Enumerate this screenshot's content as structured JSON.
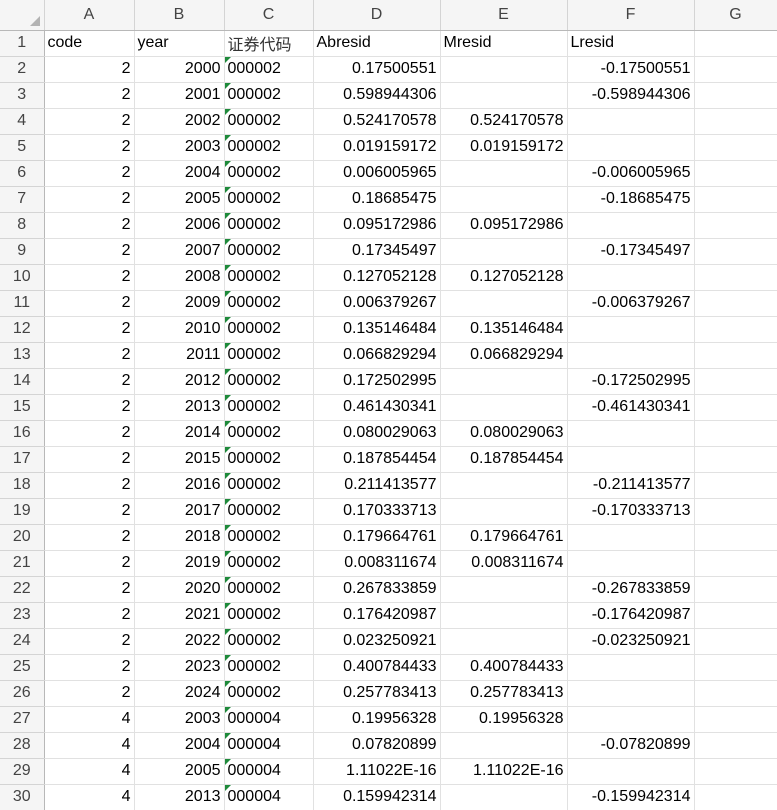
{
  "columns": [
    "A",
    "B",
    "C",
    "D",
    "E",
    "F",
    "G"
  ],
  "header_row": {
    "row_number": "1",
    "cells": [
      "code",
      "year",
      "证券代码",
      "Abresid",
      "Mresid",
      "Lresid",
      ""
    ]
  },
  "rows": [
    {
      "n": "2",
      "code": "2",
      "year": "2000",
      "sec": "000002",
      "ab": "0.17500551",
      "m": "",
      "l": "-0.17500551"
    },
    {
      "n": "3",
      "code": "2",
      "year": "2001",
      "sec": "000002",
      "ab": "0.598944306",
      "m": "",
      "l": "-0.598944306"
    },
    {
      "n": "4",
      "code": "2",
      "year": "2002",
      "sec": "000002",
      "ab": "0.524170578",
      "m": "0.524170578",
      "l": ""
    },
    {
      "n": "5",
      "code": "2",
      "year": "2003",
      "sec": "000002",
      "ab": "0.019159172",
      "m": "0.019159172",
      "l": ""
    },
    {
      "n": "6",
      "code": "2",
      "year": "2004",
      "sec": "000002",
      "ab": "0.006005965",
      "m": "",
      "l": "-0.006005965"
    },
    {
      "n": "7",
      "code": "2",
      "year": "2005",
      "sec": "000002",
      "ab": "0.18685475",
      "m": "",
      "l": "-0.18685475"
    },
    {
      "n": "8",
      "code": "2",
      "year": "2006",
      "sec": "000002",
      "ab": "0.095172986",
      "m": "0.095172986",
      "l": ""
    },
    {
      "n": "9",
      "code": "2",
      "year": "2007",
      "sec": "000002",
      "ab": "0.17345497",
      "m": "",
      "l": "-0.17345497"
    },
    {
      "n": "10",
      "code": "2",
      "year": "2008",
      "sec": "000002",
      "ab": "0.127052128",
      "m": "0.127052128",
      "l": ""
    },
    {
      "n": "11",
      "code": "2",
      "year": "2009",
      "sec": "000002",
      "ab": "0.006379267",
      "m": "",
      "l": "-0.006379267"
    },
    {
      "n": "12",
      "code": "2",
      "year": "2010",
      "sec": "000002",
      "ab": "0.135146484",
      "m": "0.135146484",
      "l": ""
    },
    {
      "n": "13",
      "code": "2",
      "year": "2011",
      "sec": "000002",
      "ab": "0.066829294",
      "m": "0.066829294",
      "l": ""
    },
    {
      "n": "14",
      "code": "2",
      "year": "2012",
      "sec": "000002",
      "ab": "0.172502995",
      "m": "",
      "l": "-0.172502995"
    },
    {
      "n": "15",
      "code": "2",
      "year": "2013",
      "sec": "000002",
      "ab": "0.461430341",
      "m": "",
      "l": "-0.461430341"
    },
    {
      "n": "16",
      "code": "2",
      "year": "2014",
      "sec": "000002",
      "ab": "0.080029063",
      "m": "0.080029063",
      "l": ""
    },
    {
      "n": "17",
      "code": "2",
      "year": "2015",
      "sec": "000002",
      "ab": "0.187854454",
      "m": "0.187854454",
      "l": ""
    },
    {
      "n": "18",
      "code": "2",
      "year": "2016",
      "sec": "000002",
      "ab": "0.211413577",
      "m": "",
      "l": "-0.211413577"
    },
    {
      "n": "19",
      "code": "2",
      "year": "2017",
      "sec": "000002",
      "ab": "0.170333713",
      "m": "",
      "l": "-0.170333713"
    },
    {
      "n": "20",
      "code": "2",
      "year": "2018",
      "sec": "000002",
      "ab": "0.179664761",
      "m": "0.179664761",
      "l": ""
    },
    {
      "n": "21",
      "code": "2",
      "year": "2019",
      "sec": "000002",
      "ab": "0.008311674",
      "m": "0.008311674",
      "l": ""
    },
    {
      "n": "22",
      "code": "2",
      "year": "2020",
      "sec": "000002",
      "ab": "0.267833859",
      "m": "",
      "l": "-0.267833859"
    },
    {
      "n": "23",
      "code": "2",
      "year": "2021",
      "sec": "000002",
      "ab": "0.176420987",
      "m": "",
      "l": "-0.176420987"
    },
    {
      "n": "24",
      "code": "2",
      "year": "2022",
      "sec": "000002",
      "ab": "0.023250921",
      "m": "",
      "l": "-0.023250921"
    },
    {
      "n": "25",
      "code": "2",
      "year": "2023",
      "sec": "000002",
      "ab": "0.400784433",
      "m": "0.400784433",
      "l": ""
    },
    {
      "n": "26",
      "code": "2",
      "year": "2024",
      "sec": "000002",
      "ab": "0.257783413",
      "m": "0.257783413",
      "l": ""
    },
    {
      "n": "27",
      "code": "4",
      "year": "2003",
      "sec": "000004",
      "ab": "0.19956328",
      "m": "0.19956328",
      "l": ""
    },
    {
      "n": "28",
      "code": "4",
      "year": "2004",
      "sec": "000004",
      "ab": "0.07820899",
      "m": "",
      "l": "-0.07820899"
    },
    {
      "n": "29",
      "code": "4",
      "year": "2005",
      "sec": "000004",
      "ab": "1.11022E-16",
      "m": "1.11022E-16",
      "l": ""
    },
    {
      "n": "30",
      "code": "4",
      "year": "2013",
      "sec": "000004",
      "ab": "0.159942314",
      "m": "",
      "l": "-0.159942314"
    }
  ],
  "colors": {
    "header_bg": "#f5f5f5",
    "gridline": "#e1e1e1",
    "text_number_marker": "#1e8a3a"
  },
  "icons": {
    "select_all": "select-all-triangle-icon",
    "number_as_text": "number-stored-as-text-icon"
  }
}
